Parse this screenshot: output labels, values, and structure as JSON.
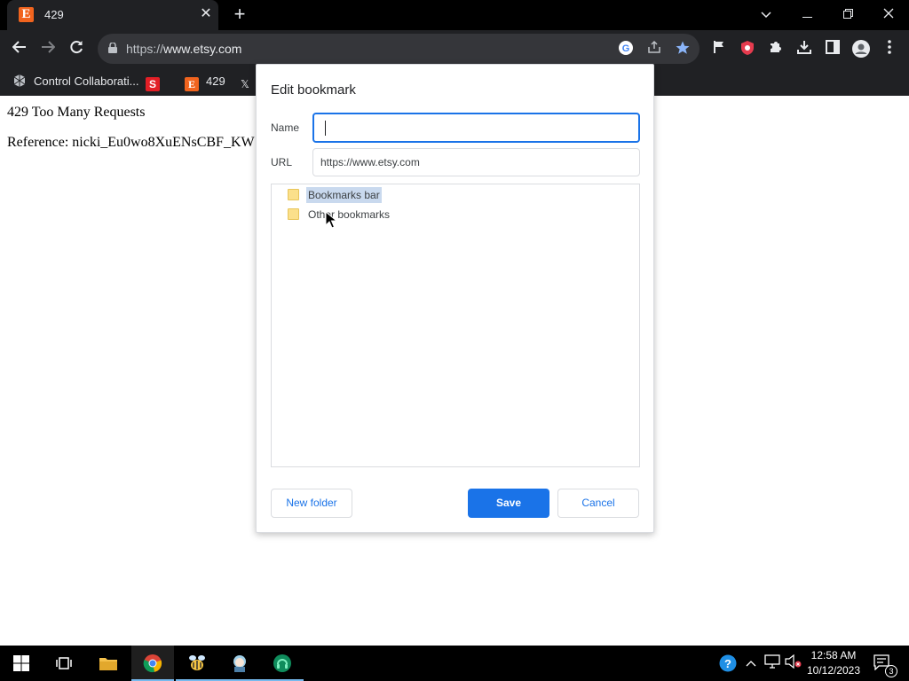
{
  "browser": {
    "tab": {
      "favicon_letter": "E",
      "title": "429",
      "close_icon": "close-icon"
    },
    "window_controls": {
      "dropdown": "chevron-down-icon",
      "minimize": "minimize-icon",
      "restore": "restore-icon",
      "close": "close-icon"
    },
    "omnibox": {
      "scheme": "https://",
      "host": "www.etsy.com"
    },
    "bookmarks": [
      {
        "label": "Control Collaborati...",
        "icon": "extension-icon"
      },
      {
        "label": "",
        "icon": "s-logo-icon",
        "letter": "S"
      },
      {
        "label": "429",
        "icon": "etsy-icon",
        "letter": "E"
      },
      {
        "label": "",
        "icon": "x-logo-icon",
        "letter": "X"
      }
    ]
  },
  "page": {
    "line1": "429 Too Many Requests",
    "line2": "Reference: nicki_Eu0wo8XuENsCBF_KW"
  },
  "dialog": {
    "title": "Edit bookmark",
    "name_label": "Name",
    "name_value": "",
    "url_label": "URL",
    "url_value": "https://www.etsy.com",
    "folders": [
      {
        "label": "Bookmarks bar",
        "selected": true
      },
      {
        "label": "Other bookmarks",
        "selected": false
      }
    ],
    "new_folder_label": "New folder",
    "save_label": "Save",
    "cancel_label": "Cancel"
  },
  "taskbar": {
    "time": "12:58 AM",
    "date": "10/12/2023",
    "notification_count": "3"
  },
  "colors": {
    "accent": "#1a73e8",
    "etsy": "#F1641E",
    "bookmark_star": "#8ab4f8"
  }
}
